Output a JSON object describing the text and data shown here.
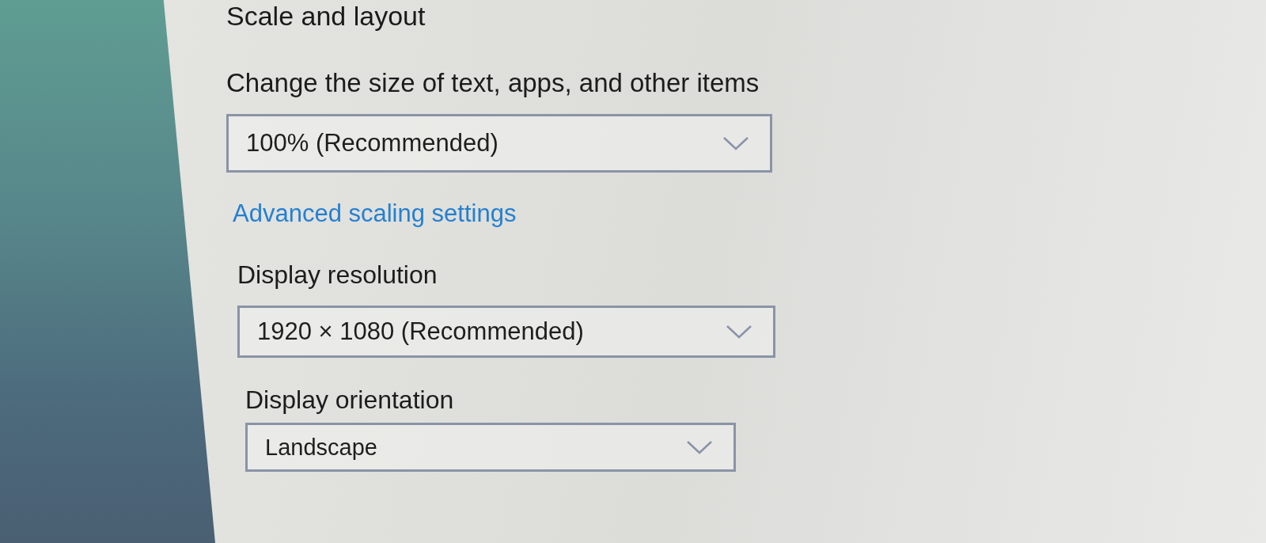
{
  "page": {
    "title": "Scale and layout"
  },
  "settings": [
    {
      "label": "Change the size of text, apps, and other items",
      "value": "100% (Recommended)",
      "link": "Advanced scaling settings"
    },
    {
      "label": "Display resolution",
      "value": "1920 × 1080 (Recommended)"
    },
    {
      "label": "Display orientation",
      "value": "Landscape"
    }
  ]
}
